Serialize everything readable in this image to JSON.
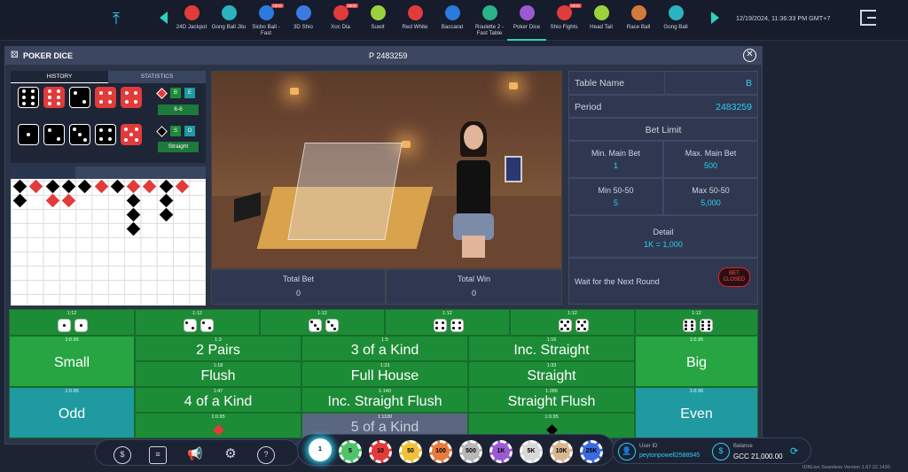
{
  "topbar": {
    "games": [
      {
        "label": "24D Jackpot",
        "color": "#e23b3b",
        "new": false
      },
      {
        "label": "Gong Ball Jitu",
        "color": "#2bb3c0",
        "new": false
      },
      {
        "label": "Sicbo Ball - Fast",
        "color": "#2b7ae0",
        "new": true
      },
      {
        "label": "3D Shio",
        "color": "#3b7ae0",
        "new": false
      },
      {
        "label": "Xoc Dia",
        "color": "#e23b3b",
        "new": true
      },
      {
        "label": "Suwit",
        "color": "#9bd23b",
        "new": false
      },
      {
        "label": "Red White",
        "color": "#e23b3b",
        "new": false
      },
      {
        "label": "Baccarat",
        "color": "#2b7ae0",
        "new": false
      },
      {
        "label": "Roulette 2 - Fast Table",
        "color": "#2bb38a",
        "new": false
      },
      {
        "label": "Poker Dice",
        "color": "#9b5ad2",
        "new": false
      },
      {
        "label": "Shio Fights",
        "color": "#e23b3b",
        "new": true
      },
      {
        "label": "Head Tail",
        "color": "#9bd23b",
        "new": false
      },
      {
        "label": "Race Ball",
        "color": "#d27a3b",
        "new": false
      },
      {
        "label": "Gong Ball",
        "color": "#2bb3c0",
        "new": false
      }
    ],
    "new_badge": "NEW",
    "clock": "12/19/2024, 11:36:33 PM GMT+7"
  },
  "panel": {
    "title": "POKER DICE",
    "period_header": "P 2483259"
  },
  "history": {
    "tab_history": "HISTORY",
    "tab_statistics": "STATISTICS",
    "row1_result": "6-6",
    "row1_badges": [
      "B",
      "E"
    ],
    "row2_result": "Straight",
    "row2_badges": [
      "S",
      "O"
    ]
  },
  "totals": {
    "total_bet_label": "Total Bet",
    "total_bet_value": "0",
    "total_win_label": "Total Win",
    "total_win_value": "0"
  },
  "info": {
    "table_name_label": "Table Name",
    "table_name_value": "B",
    "period_label": "Period",
    "period_value": "2483259",
    "bet_limit_label": "Bet Limit",
    "min_main_label": "Min. Main Bet",
    "min_main_value": "1",
    "max_main_label": "Max. Main Bet",
    "max_main_value": "500",
    "min_5050_label": "Min 50-50",
    "min_5050_value": "5",
    "max_5050_label": "Max 50-50",
    "max_5050_value": "5,000",
    "detail_label": "Detail",
    "detail_value": "1K = 1,000",
    "status": "Wait for the Next Round",
    "bet_closed_1": "BET",
    "bet_closed_2": "CLOSED"
  },
  "board": {
    "pair_odds": "1:12",
    "side_odds": "1:0.95",
    "small": "Small",
    "big": "Big",
    "odd": "Odd",
    "even": "Even",
    "two_pairs": "2 Pairs",
    "two_pairs_odds": "1:3",
    "three_kind": "3 of a Kind",
    "three_kind_odds": "1:5",
    "inc_straight": "Inc. Straight",
    "inc_straight_odds": "1:16",
    "flush": "Flush",
    "flush_odds": "1:18",
    "full_house": "Full House",
    "full_house_odds": "1:23",
    "straight": "Straight",
    "straight_odds": "1:33",
    "four_kind": "4 of a Kind",
    "four_kind_odds": "1:47",
    "inc_straight_flush": "Inc. Straight Flush",
    "inc_straight_flush_odds": "1:140",
    "straight_flush": "Straight Flush",
    "straight_flush_odds": "1:285",
    "five_kind": "5 of a Kind",
    "five_kind_odds": "1:1100",
    "red_odds": "1:0.95",
    "black_odds": "1:0.95"
  },
  "chips": [
    "1",
    "5",
    "10",
    "50",
    "100",
    "500",
    "1K",
    "5K",
    "10K",
    "25K"
  ],
  "chip_colors": [
    "#ffffff",
    "#4fc36a",
    "#e23b3b",
    "#f0c23b",
    "#e87a3b",
    "#b8b8b8",
    "#9b5ad2",
    "#d8d8d8",
    "#d8b890",
    "#3b6ae0"
  ],
  "user": {
    "id_label": "User ID",
    "id_value": "peytonpowell2588945",
    "balance_label": "Balance",
    "balance_value": "GCC 21,000.00"
  },
  "version": "IDNLive Seamless Version 1.67.22.1430"
}
